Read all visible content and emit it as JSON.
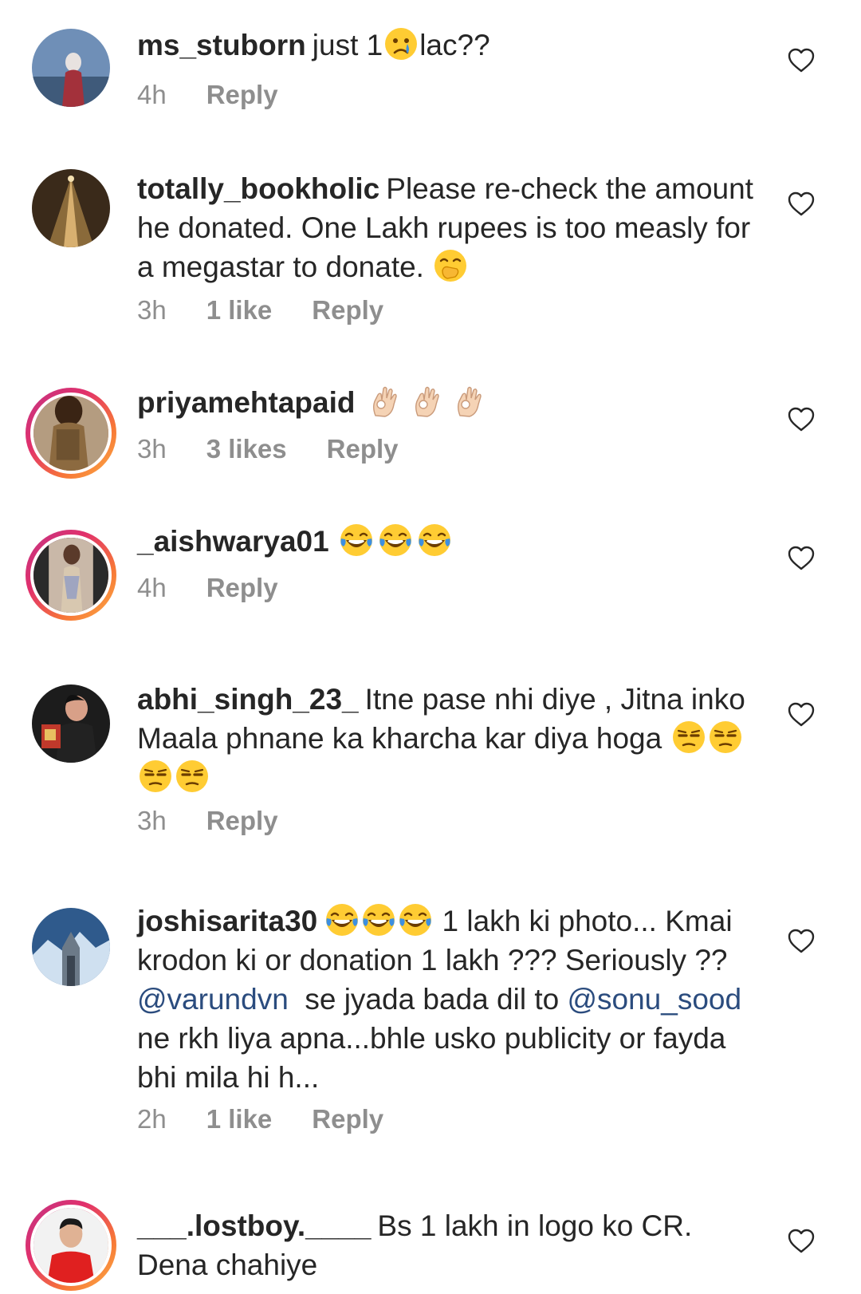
{
  "comments": [
    {
      "username": "ms_stuborn",
      "text_before": "just 1",
      "emoji": "crying-face",
      "text_after": "lac??",
      "time": "4h",
      "reply": "Reply"
    },
    {
      "username": "totally_bookholic",
      "text": "Please re-check the amount he donated. One Lakh rupees is too measly for a megastar to donate.",
      "emoji": "hand-over-mouth-face",
      "time": "3h",
      "likes": "1 like",
      "reply": "Reply"
    },
    {
      "username": "priyamehtapaid",
      "emoji": "ok-hand x3",
      "time": "3h",
      "likes": "3 likes",
      "reply": "Reply"
    },
    {
      "username": "_aishwarya01",
      "emoji": "tears-of-joy x3",
      "time": "4h",
      "reply": "Reply"
    },
    {
      "username": "abhi_singh_23_",
      "text": "Itne pase nhi diye , Jitna inko Maala phnane ka kharcha kar diya hoga",
      "emoji": "unamused-face x4",
      "time": "3h",
      "reply": "Reply"
    },
    {
      "username": "joshisarita30",
      "emoji": "tears-of-joy x3",
      "text_1": "1 lakh ki photo... Kmai krodon ki or donation 1 lakh ??? Seriously ??",
      "mention_1": "@varundvn",
      "text_2": "se jyada bada dil  to",
      "mention_2": "@sonu_sood",
      "text_3": "ne rkh liya apna...bhle usko publicity or fayda bhi mila hi h...",
      "time": "2h",
      "likes": "1 like",
      "reply": "Reply"
    },
    {
      "username": "___.lostboy.____",
      "text": "Bs 1 lakh in logo ko CR. Dena chahiye"
    }
  ],
  "icons": {
    "like": "heart-outline-icon"
  },
  "colors": {
    "text": "#262626",
    "meta": "#8e8e8e",
    "mention": "#2b4c7e",
    "story_ring": "#e1306c"
  }
}
